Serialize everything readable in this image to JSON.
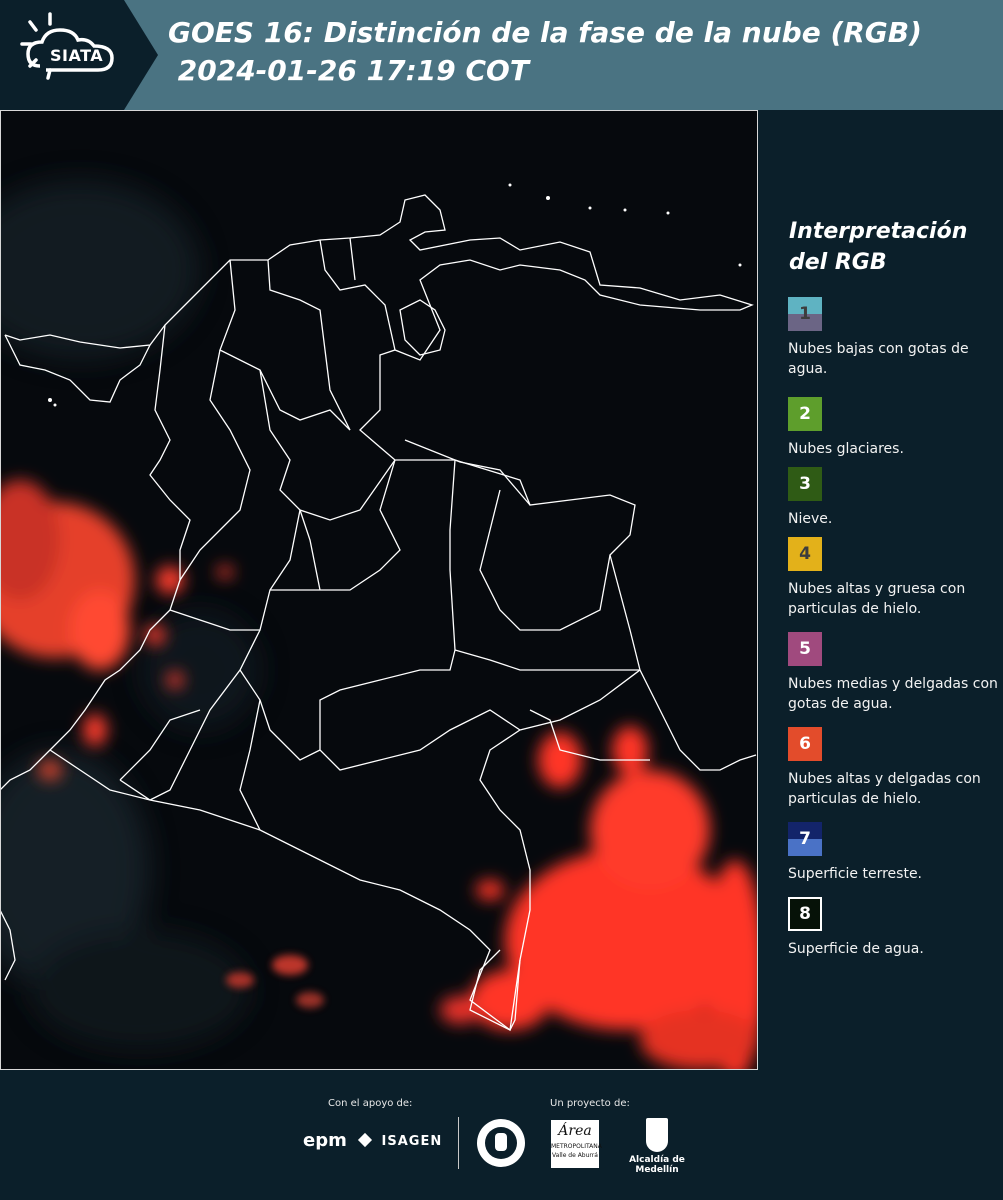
{
  "header": {
    "logo_text": "SIATA",
    "title": "GOES 16: Distinción de la fase de la nube (RGB)\n 2024-01-26 17:19 COT"
  },
  "legend": {
    "title": "Interpretación del RGB",
    "items": [
      {
        "number": "1",
        "label": "Nubes bajas con gotas de agua.",
        "colors": [
          "#5fb3c2",
          "#6b6585"
        ],
        "num_color": "#3d3d3d"
      },
      {
        "number": "2",
        "label": "Nubes glaciares.",
        "colors": [
          "#5e9e2c"
        ],
        "num_color": "#ffffff"
      },
      {
        "number": "3",
        "label": "Nieve.",
        "colors": [
          "#2f5b15"
        ],
        "num_color": "#ffffff"
      },
      {
        "number": "4",
        "label": "Nubes altas y gruesa con particulas de hielo.",
        "colors": [
          "#e3b11a"
        ],
        "num_color": "#3d3d3d"
      },
      {
        "number": "5",
        "label": "Nubes medias y delgadas con gotas de agua.",
        "colors": [
          "#a04a7e"
        ],
        "num_color": "#ffffff"
      },
      {
        "number": "6",
        "label": "Nubes altas y delgadas con particulas de hielo.",
        "colors": [
          "#e34c2b"
        ],
        "num_color": "#ffffff"
      },
      {
        "number": "7",
        "label": "Superficie terreste.",
        "colors": [
          "#13246a",
          "#4a72c6"
        ],
        "num_color": "#ffffff"
      },
      {
        "number": "8",
        "label": "Superficie de agua.",
        "colors": [
          "#061208"
        ],
        "num_color": "#ffffff",
        "border": "#ffffff"
      }
    ]
  },
  "footer": {
    "support_label": "Con el apoyo de:",
    "project_label": "Un proyecto de:",
    "partner_epm": "epm",
    "partner_isagen": "ISAGEN",
    "partner_area": "Área",
    "partner_area_sub": "METROPOLITANA",
    "partner_area_sub2": "Valle de Aburrá",
    "partner_alcaldia": "Alcaldía de Medellín"
  },
  "colors": {
    "header_bg": "#4a7382",
    "panel_bg": "#0b1f2a",
    "cloud_red": "#ff3b2a",
    "border_white": "#ffffff"
  }
}
